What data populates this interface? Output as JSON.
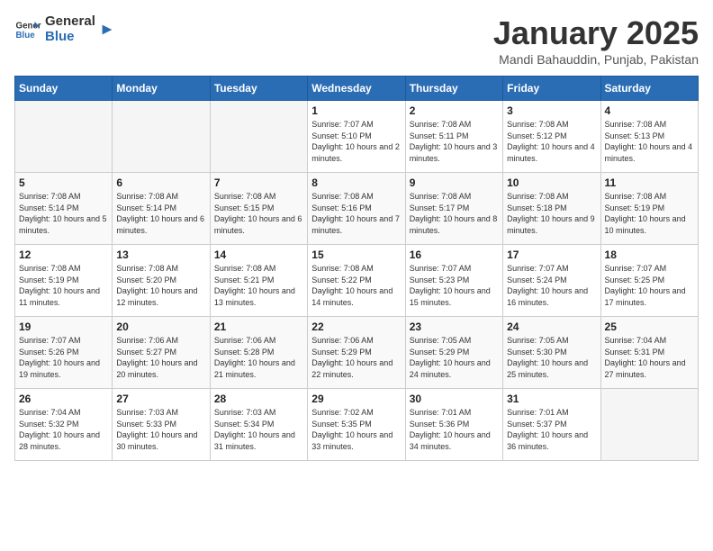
{
  "header": {
    "logo_general": "General",
    "logo_blue": "Blue",
    "month_title": "January 2025",
    "subtitle": "Mandi Bahauddin, Punjab, Pakistan"
  },
  "weekdays": [
    "Sunday",
    "Monday",
    "Tuesday",
    "Wednesday",
    "Thursday",
    "Friday",
    "Saturday"
  ],
  "weeks": [
    [
      {
        "day": "",
        "sunrise": "",
        "sunset": "",
        "daylight": "",
        "empty": true
      },
      {
        "day": "",
        "sunrise": "",
        "sunset": "",
        "daylight": "",
        "empty": true
      },
      {
        "day": "",
        "sunrise": "",
        "sunset": "",
        "daylight": "",
        "empty": true
      },
      {
        "day": "1",
        "sunrise": "Sunrise: 7:07 AM",
        "sunset": "Sunset: 5:10 PM",
        "daylight": "Daylight: 10 hours and 2 minutes."
      },
      {
        "day": "2",
        "sunrise": "Sunrise: 7:08 AM",
        "sunset": "Sunset: 5:11 PM",
        "daylight": "Daylight: 10 hours and 3 minutes."
      },
      {
        "day": "3",
        "sunrise": "Sunrise: 7:08 AM",
        "sunset": "Sunset: 5:12 PM",
        "daylight": "Daylight: 10 hours and 4 minutes."
      },
      {
        "day": "4",
        "sunrise": "Sunrise: 7:08 AM",
        "sunset": "Sunset: 5:13 PM",
        "daylight": "Daylight: 10 hours and 4 minutes."
      }
    ],
    [
      {
        "day": "5",
        "sunrise": "Sunrise: 7:08 AM",
        "sunset": "Sunset: 5:14 PM",
        "daylight": "Daylight: 10 hours and 5 minutes."
      },
      {
        "day": "6",
        "sunrise": "Sunrise: 7:08 AM",
        "sunset": "Sunset: 5:14 PM",
        "daylight": "Daylight: 10 hours and 6 minutes."
      },
      {
        "day": "7",
        "sunrise": "Sunrise: 7:08 AM",
        "sunset": "Sunset: 5:15 PM",
        "daylight": "Daylight: 10 hours and 6 minutes."
      },
      {
        "day": "8",
        "sunrise": "Sunrise: 7:08 AM",
        "sunset": "Sunset: 5:16 PM",
        "daylight": "Daylight: 10 hours and 7 minutes."
      },
      {
        "day": "9",
        "sunrise": "Sunrise: 7:08 AM",
        "sunset": "Sunset: 5:17 PM",
        "daylight": "Daylight: 10 hours and 8 minutes."
      },
      {
        "day": "10",
        "sunrise": "Sunrise: 7:08 AM",
        "sunset": "Sunset: 5:18 PM",
        "daylight": "Daylight: 10 hours and 9 minutes."
      },
      {
        "day": "11",
        "sunrise": "Sunrise: 7:08 AM",
        "sunset": "Sunset: 5:19 PM",
        "daylight": "Daylight: 10 hours and 10 minutes."
      }
    ],
    [
      {
        "day": "12",
        "sunrise": "Sunrise: 7:08 AM",
        "sunset": "Sunset: 5:19 PM",
        "daylight": "Daylight: 10 hours and 11 minutes."
      },
      {
        "day": "13",
        "sunrise": "Sunrise: 7:08 AM",
        "sunset": "Sunset: 5:20 PM",
        "daylight": "Daylight: 10 hours and 12 minutes."
      },
      {
        "day": "14",
        "sunrise": "Sunrise: 7:08 AM",
        "sunset": "Sunset: 5:21 PM",
        "daylight": "Daylight: 10 hours and 13 minutes."
      },
      {
        "day": "15",
        "sunrise": "Sunrise: 7:08 AM",
        "sunset": "Sunset: 5:22 PM",
        "daylight": "Daylight: 10 hours and 14 minutes."
      },
      {
        "day": "16",
        "sunrise": "Sunrise: 7:07 AM",
        "sunset": "Sunset: 5:23 PM",
        "daylight": "Daylight: 10 hours and 15 minutes."
      },
      {
        "day": "17",
        "sunrise": "Sunrise: 7:07 AM",
        "sunset": "Sunset: 5:24 PM",
        "daylight": "Daylight: 10 hours and 16 minutes."
      },
      {
        "day": "18",
        "sunrise": "Sunrise: 7:07 AM",
        "sunset": "Sunset: 5:25 PM",
        "daylight": "Daylight: 10 hours and 17 minutes."
      }
    ],
    [
      {
        "day": "19",
        "sunrise": "Sunrise: 7:07 AM",
        "sunset": "Sunset: 5:26 PM",
        "daylight": "Daylight: 10 hours and 19 minutes."
      },
      {
        "day": "20",
        "sunrise": "Sunrise: 7:06 AM",
        "sunset": "Sunset: 5:27 PM",
        "daylight": "Daylight: 10 hours and 20 minutes."
      },
      {
        "day": "21",
        "sunrise": "Sunrise: 7:06 AM",
        "sunset": "Sunset: 5:28 PM",
        "daylight": "Daylight: 10 hours and 21 minutes."
      },
      {
        "day": "22",
        "sunrise": "Sunrise: 7:06 AM",
        "sunset": "Sunset: 5:29 PM",
        "daylight": "Daylight: 10 hours and 22 minutes."
      },
      {
        "day": "23",
        "sunrise": "Sunrise: 7:05 AM",
        "sunset": "Sunset: 5:29 PM",
        "daylight": "Daylight: 10 hours and 24 minutes."
      },
      {
        "day": "24",
        "sunrise": "Sunrise: 7:05 AM",
        "sunset": "Sunset: 5:30 PM",
        "daylight": "Daylight: 10 hours and 25 minutes."
      },
      {
        "day": "25",
        "sunrise": "Sunrise: 7:04 AM",
        "sunset": "Sunset: 5:31 PM",
        "daylight": "Daylight: 10 hours and 27 minutes."
      }
    ],
    [
      {
        "day": "26",
        "sunrise": "Sunrise: 7:04 AM",
        "sunset": "Sunset: 5:32 PM",
        "daylight": "Daylight: 10 hours and 28 minutes."
      },
      {
        "day": "27",
        "sunrise": "Sunrise: 7:03 AM",
        "sunset": "Sunset: 5:33 PM",
        "daylight": "Daylight: 10 hours and 30 minutes."
      },
      {
        "day": "28",
        "sunrise": "Sunrise: 7:03 AM",
        "sunset": "Sunset: 5:34 PM",
        "daylight": "Daylight: 10 hours and 31 minutes."
      },
      {
        "day": "29",
        "sunrise": "Sunrise: 7:02 AM",
        "sunset": "Sunset: 5:35 PM",
        "daylight": "Daylight: 10 hours and 33 minutes."
      },
      {
        "day": "30",
        "sunrise": "Sunrise: 7:01 AM",
        "sunset": "Sunset: 5:36 PM",
        "daylight": "Daylight: 10 hours and 34 minutes."
      },
      {
        "day": "31",
        "sunrise": "Sunrise: 7:01 AM",
        "sunset": "Sunset: 5:37 PM",
        "daylight": "Daylight: 10 hours and 36 minutes."
      },
      {
        "day": "",
        "sunrise": "",
        "sunset": "",
        "daylight": "",
        "empty": true
      }
    ]
  ]
}
